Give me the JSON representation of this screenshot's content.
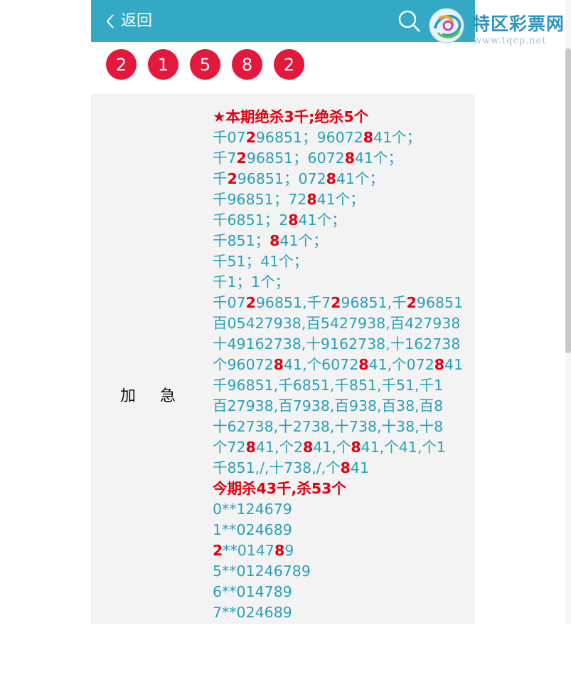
{
  "header": {
    "back_label": "返回"
  },
  "balls": [
    "2",
    "1",
    "5",
    "8",
    "2"
  ],
  "row_label": "加急",
  "watermark": {
    "name": "特区彩票网",
    "url": "www.tqcp.net"
  },
  "colors": {
    "header_bg": "#33a9c6",
    "ball": "#e2193c",
    "accent_red": "#e00012",
    "text_teal": "#2aa0b8"
  },
  "lines": [
    {
      "style": "title",
      "segments": [
        {
          "t": "★本期绝杀3千;绝杀5个",
          "r": true
        }
      ]
    },
    {
      "segments": [
        {
          "t": "千07"
        },
        {
          "t": "2",
          "r": true
        },
        {
          "t": "96851；96072"
        },
        {
          "t": "8",
          "r": true
        },
        {
          "t": "41个；"
        }
      ]
    },
    {
      "segments": [
        {
          "t": "千7"
        },
        {
          "t": "2",
          "r": true
        },
        {
          "t": "96851；6072"
        },
        {
          "t": "8",
          "r": true
        },
        {
          "t": "41个；"
        }
      ]
    },
    {
      "segments": [
        {
          "t": "千"
        },
        {
          "t": "2",
          "r": true
        },
        {
          "t": "96851；072"
        },
        {
          "t": "8",
          "r": true
        },
        {
          "t": "41个；"
        }
      ]
    },
    {
      "segments": [
        {
          "t": "千96851；72"
        },
        {
          "t": "8",
          "r": true
        },
        {
          "t": "41个；"
        }
      ]
    },
    {
      "segments": [
        {
          "t": "千6851；2"
        },
        {
          "t": "8",
          "r": true
        },
        {
          "t": "41个；"
        }
      ]
    },
    {
      "segments": [
        {
          "t": "千851；"
        },
        {
          "t": "8",
          "r": true
        },
        {
          "t": "41个；"
        }
      ]
    },
    {
      "segments": [
        {
          "t": "千51；41个；"
        }
      ]
    },
    {
      "segments": [
        {
          "t": "千1；1个；"
        }
      ]
    },
    {
      "segments": [
        {
          "t": "千07"
        },
        {
          "t": "2",
          "r": true
        },
        {
          "t": "96851,千7"
        },
        {
          "t": "2",
          "r": true
        },
        {
          "t": "96851,千"
        },
        {
          "t": "2",
          "r": true
        },
        {
          "t": "96851"
        }
      ]
    },
    {
      "segments": [
        {
          "t": "百05427938,百5427938,百427938"
        }
      ]
    },
    {
      "segments": [
        {
          "t": "十49162738,十9162738,十162738"
        }
      ]
    },
    {
      "segments": [
        {
          "t": "个96072"
        },
        {
          "t": "8",
          "r": true
        },
        {
          "t": "41,个6072"
        },
        {
          "t": "8",
          "r": true
        },
        {
          "t": "41,个072"
        },
        {
          "t": "8",
          "r": true
        },
        {
          "t": "41"
        }
      ]
    },
    {
      "segments": [
        {
          "t": "千96851,千6851,千851,千51,千1"
        }
      ]
    },
    {
      "segments": [
        {
          "t": "百27938,百7938,百938,百38,百8"
        }
      ]
    },
    {
      "segments": [
        {
          "t": "十62738,十2738,十738,十38,十8"
        }
      ]
    },
    {
      "segments": [
        {
          "t": "个72"
        },
        {
          "t": "8",
          "r": true
        },
        {
          "t": "41,个2"
        },
        {
          "t": "8",
          "r": true
        },
        {
          "t": "41,个"
        },
        {
          "t": "8",
          "r": true
        },
        {
          "t": "41,个41,个1"
        }
      ]
    },
    {
      "segments": [
        {
          "t": "千851,/,十738,/,个"
        },
        {
          "t": "8",
          "r": true
        },
        {
          "t": "41"
        }
      ]
    },
    {
      "style": "title",
      "segments": [
        {
          "t": "今期杀43千,杀53个",
          "r": true
        }
      ]
    },
    {
      "segments": [
        {
          "t": "0**124679"
        }
      ]
    },
    {
      "segments": [
        {
          "t": "1**024689"
        }
      ]
    },
    {
      "segments": [
        {
          "t": "2",
          "r": true
        },
        {
          "t": "**0147"
        },
        {
          "t": "8",
          "r": true
        },
        {
          "t": "9"
        }
      ]
    },
    {
      "segments": [
        {
          "t": "5**01246789"
        }
      ]
    },
    {
      "segments": [
        {
          "t": "6**014789"
        }
      ]
    },
    {
      "segments": [
        {
          "t": "7**024689"
        }
      ]
    }
  ]
}
